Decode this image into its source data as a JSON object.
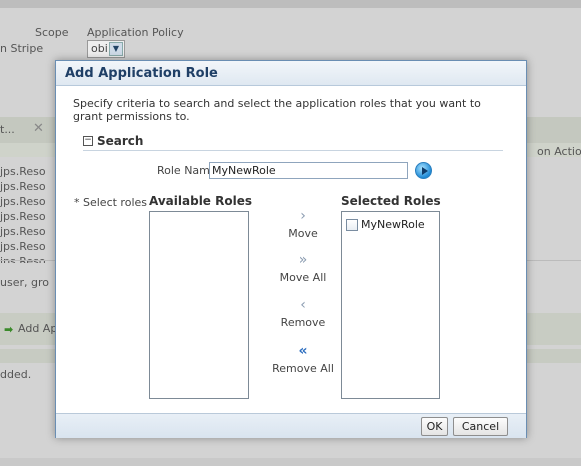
{
  "background": {
    "scope_label": "Scope",
    "scope_value": "Application Policy",
    "stripe_label": "n Stripe",
    "stripe_value": "obi",
    "search_text": "t...",
    "action_text": "on Action",
    "resource_rows": [
      "jps.Reso",
      "jps.Reso",
      "jps.Reso",
      "jps.Reso",
      "jps.Reso",
      "jps.Reso",
      "jps.Reso"
    ],
    "user_text": "user, gro",
    "add_link": "Add Ap",
    "added_text": "dded."
  },
  "dialog": {
    "title": "Add Application Role",
    "instructions": "Specify criteria to search and select the application roles that you want to grant permissions to.",
    "section_title": "Search",
    "disclose_symbol": "−",
    "role_name_label": "Role Name",
    "role_name_value": "MyNewRole",
    "select_roles_label": "* Select roles",
    "available_roles_header": "Available Roles",
    "selected_roles_header": "Selected Roles",
    "available_roles": [],
    "selected_roles": [
      "MyNewRole"
    ],
    "shuttle": {
      "move_label": "Move",
      "move_all_label": "Move All",
      "remove_label": "Remove",
      "remove_all_label": "Remove All",
      "move_glyph": "›",
      "move_all_glyph": "»",
      "remove_glyph": "‹",
      "remove_all_glyph": "«"
    },
    "ok_label": "OK",
    "cancel_label": "Cancel"
  },
  "colors": {
    "title_text": "#1f3f66",
    "dialog_border": "#6a8eb3",
    "active_shuttle": "#2e6fc0"
  }
}
